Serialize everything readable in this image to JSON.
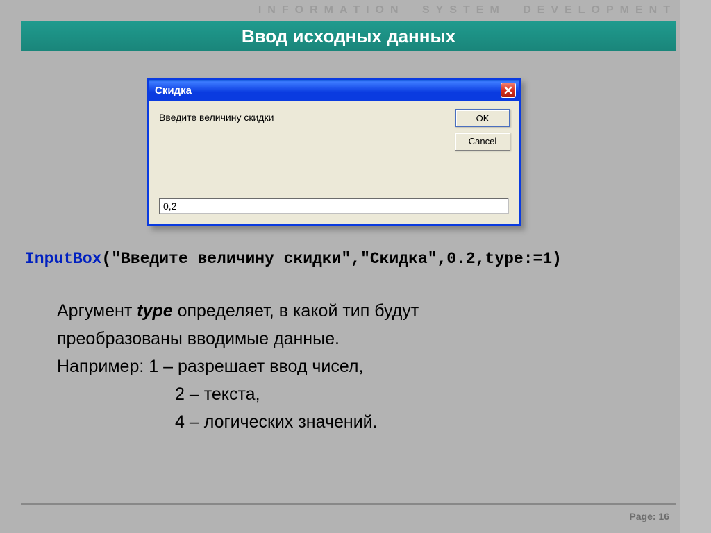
{
  "header": {
    "letterhead": "INFORMATION SYSTEM  DEVELOPMENT"
  },
  "slide": {
    "title": "Ввод исходных данных"
  },
  "dialog": {
    "title": "Скидка",
    "prompt": "Введите величину скидки",
    "ok_label": "OK",
    "cancel_label": "Cancel",
    "input_value": "0,2"
  },
  "code": {
    "fn": "InputBox",
    "args": "(\"Введите величину скидки\",\"Скидка\",0.2,type:=1)"
  },
  "text": {
    "p1a": "Аргумент ",
    "p1_emph": "type",
    "p1b": "  определяет, в какой тип будут",
    "p2": "преобразованы вводимые данные.",
    "ex_label": "Например:  1 – разрешает ввод чисел,",
    "ex2": "2 – текста,",
    "ex3": "4 – логических значений."
  },
  "footer": {
    "page": "Page: 16"
  }
}
